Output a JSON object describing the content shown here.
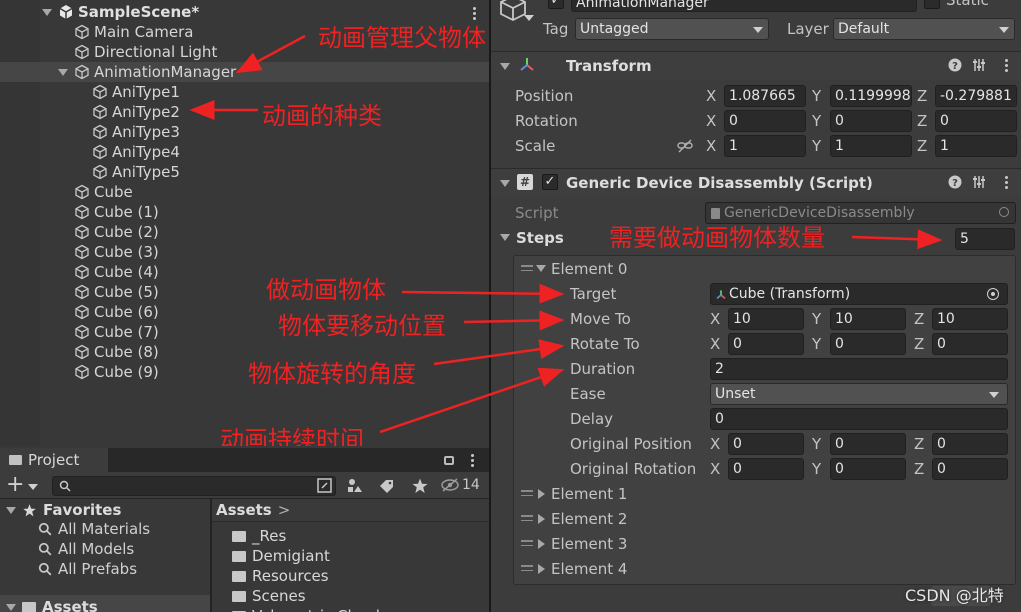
{
  "hierarchy": {
    "scene": "SampleScene*",
    "items": [
      {
        "label": "Main Camera"
      },
      {
        "label": "Directional Light"
      },
      {
        "label": "AnimationManager"
      },
      {
        "label": "AniType1"
      },
      {
        "label": "AniType2"
      },
      {
        "label": "AniType3"
      },
      {
        "label": "AniType4"
      },
      {
        "label": "AniType5"
      },
      {
        "label": "Cube"
      },
      {
        "label": "Cube (1)"
      },
      {
        "label": "Cube (2)"
      },
      {
        "label": "Cube (3)"
      },
      {
        "label": "Cube (4)"
      },
      {
        "label": "Cube (5)"
      },
      {
        "label": "Cube (6)"
      },
      {
        "label": "Cube (7)"
      },
      {
        "label": "Cube (8)"
      },
      {
        "label": "Cube (9)"
      }
    ]
  },
  "annotations": {
    "parent": "动画管理父物体",
    "types": "动画的种类",
    "count": "需要做动画物体数量",
    "target": "做动画物体",
    "move": "物体要移动位置",
    "rotate": "物体旋转的角度",
    "duration": "动画持续时间"
  },
  "project": {
    "tab": "Project",
    "hidden_count": "14",
    "favorites": {
      "title": "Favorites",
      "items": [
        "All Materials",
        "All Models",
        "All Prefabs"
      ]
    },
    "assets_root": "Assets",
    "breadcrumb": "Assets",
    "folders": [
      "_Res",
      "Demigiant",
      "Resources",
      "Scenes",
      "Volumetric Clouds"
    ]
  },
  "inspector": {
    "object_name": "AnimationManager",
    "static_label": "Static",
    "tag_label": "Tag",
    "tag_value": "Untagged",
    "layer_label": "Layer",
    "layer_value": "Default",
    "transform": {
      "title": "Transform",
      "position": {
        "label": "Position",
        "x": "1.087665",
        "y": "0.1199998",
        "z": "-0.279881"
      },
      "rotation": {
        "label": "Rotation",
        "x": "0",
        "y": "0",
        "z": "0"
      },
      "scale": {
        "label": "Scale",
        "x": "1",
        "y": "1",
        "z": "1"
      }
    },
    "script_component": {
      "title": "Generic Device Disassembly (Script)",
      "script_label": "Script",
      "script_value": "GenericDeviceDisassembly",
      "steps_label": "Steps",
      "steps_count": "5",
      "element0": {
        "label": "Element 0",
        "target_label": "Target",
        "target_value": "Cube (Transform)",
        "move_label": "Move To",
        "move": {
          "x": "10",
          "y": "10",
          "z": "10"
        },
        "rotate_label": "Rotate To",
        "rotate": {
          "x": "0",
          "y": "0",
          "z": "0"
        },
        "duration_label": "Duration",
        "duration_value": "2",
        "ease_label": "Ease",
        "ease_value": "Unset",
        "delay_label": "Delay",
        "delay_value": "0",
        "origpos_label": "Original Position",
        "origpos": {
          "x": "0",
          "y": "0",
          "z": "0"
        },
        "origrot_label": "Original Rotation",
        "origrot": {
          "x": "0",
          "y": "0",
          "z": "0"
        }
      },
      "collapsed_elements": [
        "Element 1",
        "Element 2",
        "Element 3",
        "Element 4"
      ]
    },
    "watermark": "CSDN @北特"
  }
}
